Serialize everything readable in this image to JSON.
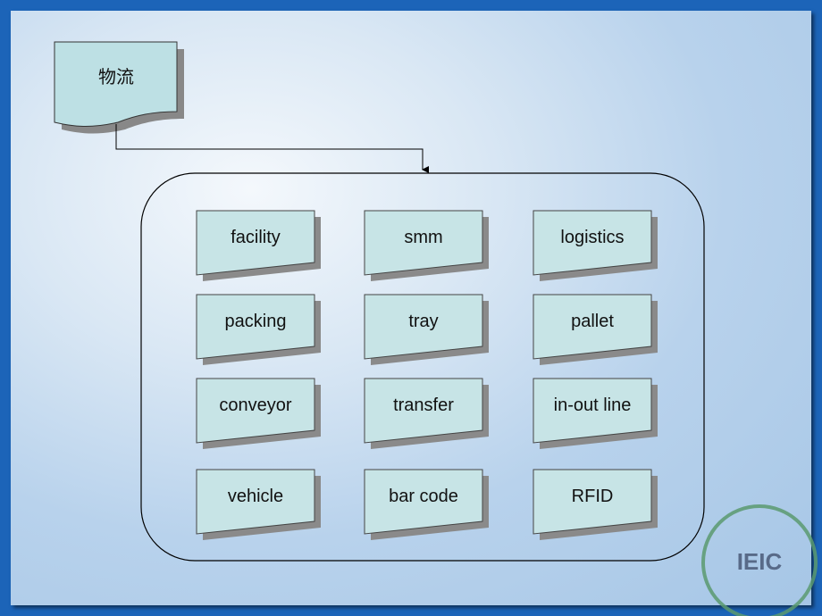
{
  "title": "物流",
  "items": [
    "facility",
    "smm",
    "logistics",
    "packing",
    "tray",
    "pallet",
    "conveyor",
    "transfer",
    "in-out line",
    "vehicle",
    "bar code",
    "RFID"
  ],
  "logo": "IEIC",
  "colors": {
    "box_fill": "#c7e4e6",
    "frame": "#1c64b8"
  }
}
